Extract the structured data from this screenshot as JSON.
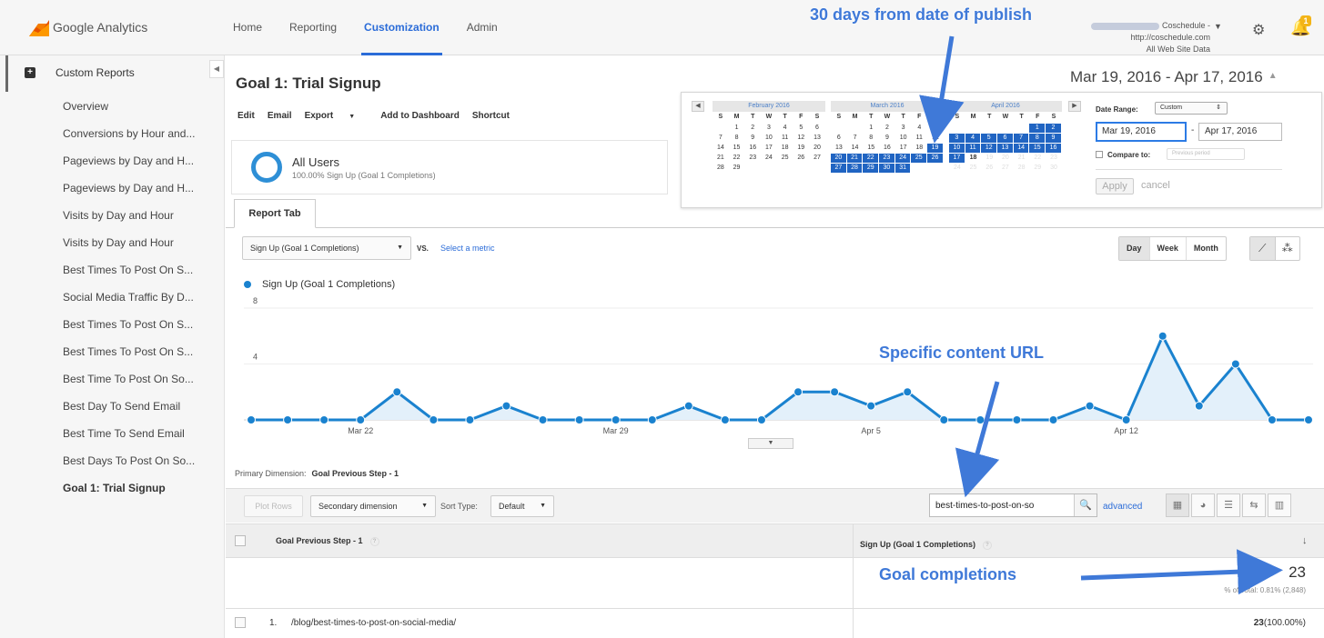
{
  "app": {
    "name": "Google Analytics"
  },
  "nav": {
    "items": [
      "Home",
      "Reporting",
      "Customization",
      "Admin"
    ],
    "active": "Customization"
  },
  "account": {
    "line1": "Coschedule - http://coschedule.com",
    "line2": "All Web Site Data",
    "notification_count": "1"
  },
  "sidebar": {
    "header": "Custom Reports",
    "items": [
      "Overview",
      "Conversions by Hour and...",
      "Pageviews by Day and H...",
      "Pageviews by Day and H...",
      "Visits by Day and Hour",
      "Visits by Day and Hour",
      "Best Times To Post On S...",
      "Social Media Traffic By D...",
      "Best Times To Post On S...",
      "Best Times To Post On S...",
      "Best Time To Post On So...",
      "Best Day To Send Email",
      "Best Time To Send Email",
      "Best Days To Post On So...",
      "Goal 1: Trial Signup"
    ],
    "active_index": 14
  },
  "report": {
    "title": "Goal 1: Trial Signup",
    "actions": [
      "Edit",
      "Email",
      "Export",
      "Add to Dashboard",
      "Shortcut"
    ],
    "date_range": "Mar 19, 2016 - Apr 17, 2016",
    "segment": {
      "name": "All Users",
      "sub": "100.00% Sign Up (Goal 1 Completions)"
    },
    "tab": "Report Tab"
  },
  "calendar": {
    "months": [
      {
        "name": "February 2016",
        "weeks": [
          [
            "",
            "1",
            "2",
            "3",
            "4",
            "5",
            "6"
          ],
          [
            "7",
            "8",
            "9",
            "10",
            "11",
            "12",
            "13"
          ],
          [
            "14",
            "15",
            "16",
            "17",
            "18",
            "19",
            "20"
          ],
          [
            "21",
            "22",
            "23",
            "24",
            "25",
            "26",
            "27"
          ],
          [
            "28",
            "29",
            "",
            "",
            "",
            "",
            ""
          ]
        ]
      },
      {
        "name": "March 2016",
        "weeks": [
          [
            "",
            "",
            "1",
            "2",
            "3",
            "4",
            "5"
          ],
          [
            "6",
            "7",
            "8",
            "9",
            "10",
            "11",
            "12"
          ],
          [
            "13",
            "14",
            "15",
            "16",
            "17",
            "18",
            "19"
          ],
          [
            "20",
            "21",
            "22",
            "23",
            "24",
            "25",
            "26"
          ],
          [
            "27",
            "28",
            "29",
            "30",
            "31",
            "",
            ""
          ]
        ]
      },
      {
        "name": "April 2016",
        "weeks": [
          [
            "",
            "",
            "",
            "",
            "",
            "1",
            "2"
          ],
          [
            "3",
            "4",
            "5",
            "6",
            "7",
            "8",
            "9"
          ],
          [
            "10",
            "11",
            "12",
            "13",
            "14",
            "15",
            "16"
          ],
          [
            "17",
            "18",
            "19",
            "20",
            "21",
            "22",
            "23"
          ],
          [
            "24",
            "25",
            "26",
            "27",
            "28",
            "29",
            "30"
          ]
        ]
      }
    ],
    "dow": [
      "S",
      "M",
      "T",
      "W",
      "T",
      "F",
      "S"
    ],
    "date_range_label": "Date Range:",
    "date_range_value": "Custom",
    "start": "Mar 19, 2016",
    "end": "Apr 17, 2016",
    "compare_label": "Compare to:",
    "compare_value": "Previous period",
    "apply": "Apply",
    "cancel": "cancel"
  },
  "chart_controls": {
    "metric": "Sign Up (Goal 1 Completions)",
    "vs": "VS.",
    "select_metric": "Select a metric",
    "granularity": [
      "Day",
      "Week",
      "Month"
    ]
  },
  "chart_data": {
    "type": "line",
    "series": [
      {
        "name": "Sign Up (Goal 1 Completions)",
        "color": "#1a82cf",
        "values": [
          0,
          0,
          0,
          0,
          2,
          0,
          0,
          1,
          0,
          0,
          0,
          0,
          1,
          0,
          0,
          2,
          2,
          1,
          2,
          0,
          0,
          0,
          0,
          1,
          0,
          6,
          1,
          4,
          0,
          0
        ]
      }
    ],
    "x_ticks": [
      {
        "index": 3,
        "label": "Mar 22"
      },
      {
        "index": 10,
        "label": "Mar 29"
      },
      {
        "index": 17,
        "label": "Apr 5"
      },
      {
        "index": 24,
        "label": "Apr 12"
      }
    ],
    "y_ticks": [
      "8",
      "4"
    ],
    "ylim": [
      0,
      8
    ],
    "grid": true
  },
  "table": {
    "primary_dimension_label": "Primary Dimension:",
    "primary_dimension": "Goal Previous Step - 1",
    "plot_rows": "Plot Rows",
    "secondary_dimension": "Secondary dimension",
    "sort_type_label": "Sort Type:",
    "sort_type": "Default",
    "search_value": "best-times-to-post-on-so",
    "advanced": "advanced",
    "col1": "Goal Previous Step - 1",
    "col2": "Sign Up (Goal 1 Completions)",
    "total": "23",
    "total_sub": "% of Total: 0.81% (2,848)",
    "rows": [
      {
        "num": "1.",
        "page": "/blog/best-times-to-post-on-social-media/",
        "value": "23",
        "pct": "(100.00%)"
      }
    ]
  },
  "annotations": {
    "publish": "30 days from date of publish",
    "url": "Specific content URL",
    "goals": "Goal completions",
    "color": "#3f79d8"
  }
}
